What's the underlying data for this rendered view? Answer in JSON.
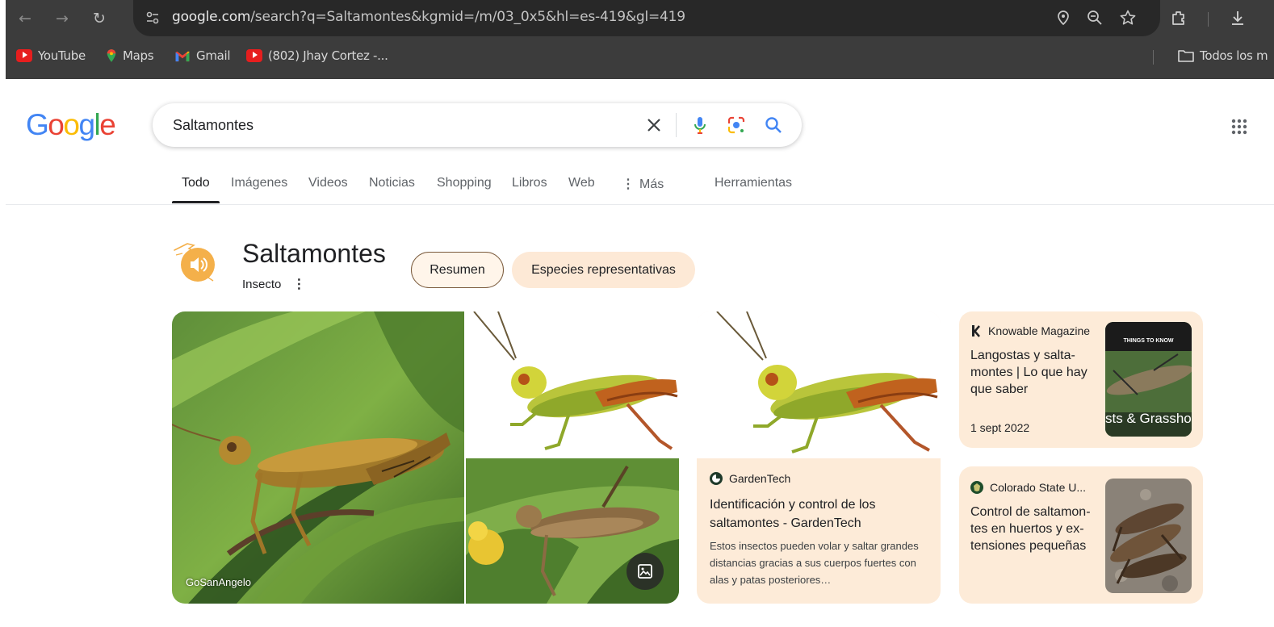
{
  "browser": {
    "url_host": "google.com",
    "url_rest": "/search?q=Saltamontes&kgmid=/m/03_0x5&hl=es-419&gl=419",
    "bookmarks": [
      {
        "label": "YouTube"
      },
      {
        "label": "Maps"
      },
      {
        "label": "Gmail"
      },
      {
        "label": "(802) Jhay Cortez -..."
      }
    ],
    "all_bookmarks_label": "Todos los m"
  },
  "google": {
    "logo_letters": [
      "G",
      "o",
      "o",
      "g",
      "l",
      "e"
    ],
    "search_query": "Saltamontes",
    "tabs": [
      {
        "label": "Todo"
      },
      {
        "label": "Imágenes"
      },
      {
        "label": "Videos"
      },
      {
        "label": "Noticias"
      },
      {
        "label": "Shopping"
      },
      {
        "label": "Libros"
      },
      {
        "label": "Web"
      },
      {
        "label": "Más"
      },
      {
        "label": "Herramientas"
      }
    ]
  },
  "knowledge": {
    "title": "Saltamontes",
    "subtitle": "Insecto",
    "chips": [
      "Resumen",
      "Especies representativas"
    ],
    "image_credit": "GoSanAngelo"
  },
  "cards": {
    "gardentech": {
      "source": "GardenTech",
      "title": "Identificación y control de los saltamontes - GardenTech",
      "description": "Estos insectos pueden volar y saltar grandes distancias gracias a sus cuerpos fuertes con alas y patas posteriores…"
    },
    "knowable": {
      "source": "Knowable Magazine",
      "title": "Langostas y salta-montes | Lo que hay que saber",
      "date": "1 sept 2022",
      "thumb_top_text": "THINGS TO KNOW",
      "thumb_bottom_text": "sts & Grassho"
    },
    "colorado": {
      "source": "Colorado State U...",
      "title": "Control de saltamon-tes en huertos y ex-tensiones pequeñas"
    }
  },
  "colors": {
    "chrome_bg": "#3c3c3c",
    "omnibox_bg": "#282828",
    "card_bg": "#fdebd8",
    "chip_bg": "#fde9d6",
    "accent_orange": "#f4b04a"
  },
  "icons": {
    "back": "back-arrow-icon",
    "forward": "forward-arrow-icon",
    "reload": "reload-icon",
    "clear": "close-icon",
    "voice": "microphone-icon",
    "lens": "google-lens-icon",
    "search": "search-icon",
    "apps": "apps-grid-icon"
  }
}
